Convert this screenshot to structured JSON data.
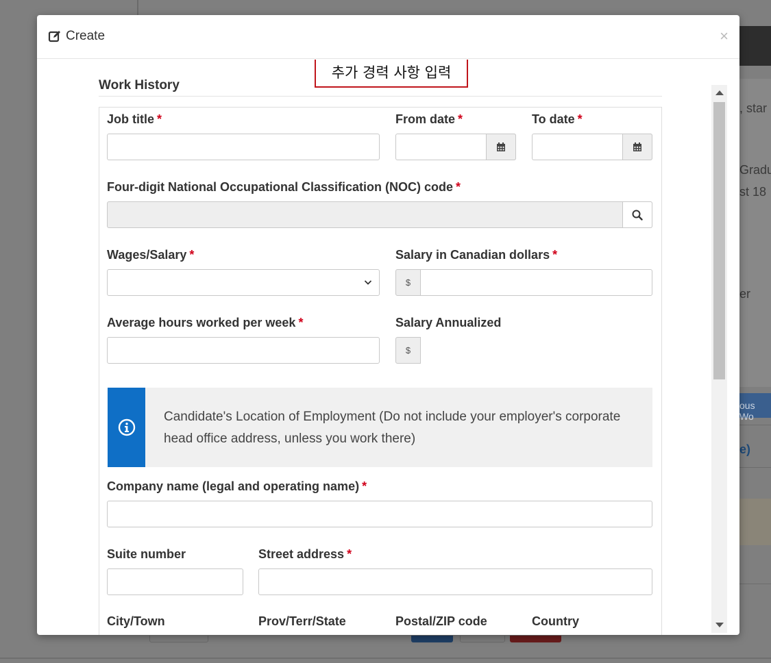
{
  "background": {
    "snippets": [
      ", star",
      "Gradu",
      "st 18",
      "er"
    ],
    "button_label": "ous Wo",
    "link_text": "e)"
  },
  "modal": {
    "title": "Create",
    "close_label": "×",
    "annotation": "추가 경력 사항 입력",
    "section_title": "Work History",
    "fields": {
      "job_title": "Job title",
      "from_date": "From date",
      "to_date": "To date",
      "noc_code": "Four-digit National Occupational Classification (NOC) code",
      "wages_salary": "Wages/Salary",
      "salary_cad": "Salary in Canadian dollars",
      "avg_hours": "Average hours worked per week",
      "salary_annualized": "Salary Annualized",
      "company_name": "Company name (legal and operating name)",
      "suite_number": "Suite number",
      "street_address": "Street address"
    },
    "required_marker": "*",
    "currency_symbol": "$",
    "info_text": "Candidate's Location of Employment (Do not include your employer's corporate head office address, unless you work there)",
    "partial_labels": [
      "City/Town",
      "Prov/Terr/State",
      "Postal/ZIP code",
      "Country"
    ],
    "colors": {
      "info_blue": "#0f6fc6",
      "required_red": "#d0021b",
      "annotation_border": "#c0151b"
    }
  }
}
